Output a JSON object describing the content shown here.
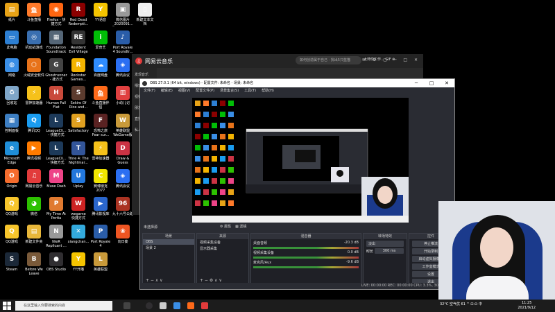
{
  "desktop_icons": [
    {
      "label": "纸片",
      "color": "#e8a317",
      "glyph": "▤",
      "col": 0,
      "row": 0
    },
    {
      "label": "斗鱼直播",
      "color": "#ff7a2a",
      "glyph": "鱼",
      "col": 1,
      "row": 0
    },
    {
      "label": "Firefox - 快\n捷方式",
      "color": "#ff6611",
      "glyph": "◉",
      "col": 2,
      "row": 0
    },
    {
      "label": "Red Dead\nRedempti...",
      "color": "#8b0000",
      "glyph": "R",
      "col": 3,
      "row": 0
    },
    {
      "label": "YY语音",
      "color": "#f5c400",
      "glyph": "Y",
      "col": 4,
      "row": 0
    },
    {
      "label": "微信图片\n_2020091...",
      "color": "#999999",
      "glyph": "▣",
      "col": 5,
      "row": 0
    },
    {
      "label": "新建文本文\n档",
      "color": "#eeeeee",
      "glyph": "▯",
      "col": 6,
      "row": 0
    },
    {
      "label": "此电脑",
      "color": "#2d7fd3",
      "glyph": "▭",
      "col": 0,
      "row": 1
    },
    {
      "label": "机动战游戏",
      "color": "#3a6fb0",
      "glyph": "◎",
      "col": 1,
      "row": 1
    },
    {
      "label": "Foundation\nSoundtrack",
      "color": "#556677",
      "glyph": "▦",
      "col": 2,
      "row": 1
    },
    {
      "label": "Resident\nEvil Village",
      "color": "#333333",
      "glyph": "RE",
      "col": 3,
      "row": 1
    },
    {
      "label": "爱奇艺",
      "color": "#00be06",
      "glyph": "i",
      "col": 4,
      "row": 1
    },
    {
      "label": "Port Royale\n4 Soundtr...",
      "color": "#2a5da8",
      "glyph": "♪",
      "col": 5,
      "row": 1
    },
    {
      "label": "网络",
      "color": "#3a8ee6",
      "glyph": "◍",
      "col": 0,
      "row": 2
    },
    {
      "label": "火绒安全软件",
      "color": "#e8731a",
      "glyph": "⬡",
      "col": 1,
      "row": 2
    },
    {
      "label": "Ghostrunner\n- 捷方式",
      "color": "#444444",
      "glyph": "G",
      "col": 2,
      "row": 2
    },
    {
      "label": "Rockstar\nGames...",
      "color": "#f4b400",
      "glyph": "R",
      "col": 3,
      "row": 2
    },
    {
      "label": "百度网盘",
      "color": "#2f8cff",
      "glyph": "☁",
      "col": 4,
      "row": 2
    },
    {
      "label": "腾讯会议",
      "color": "#2b6ff2",
      "glyph": "◈",
      "col": 5,
      "row": 2
    },
    {
      "label": "回收站",
      "color": "#7fa6c8",
      "glyph": "♻",
      "col": 0,
      "row": 3
    },
    {
      "label": "雷神加速器",
      "color": "#f6c11a",
      "glyph": "⚡",
      "col": 1,
      "row": 3
    },
    {
      "label": "Human Fall\nFlat",
      "color": "#c94a3b",
      "glyph": "H",
      "col": 2,
      "row": 3
    },
    {
      "label": "Sekiro Of\nRice and...",
      "color": "#5c3b2e",
      "glyph": "S",
      "col": 3,
      "row": 3
    },
    {
      "label": "斗鱼直播伴\n侣",
      "color": "#ff6a1a",
      "glyph": "鱼",
      "col": 4,
      "row": 3
    },
    {
      "label": "小幼儿记",
      "color": "#e04040",
      "glyph": "▥",
      "col": 5,
      "row": 3
    },
    {
      "label": "控制面板",
      "color": "#3d7ec2",
      "glyph": "▦",
      "col": 0,
      "row": 4
    },
    {
      "label": "腾讯QQ",
      "color": "#1a9cf0",
      "glyph": "Q",
      "col": 1,
      "row": 4
    },
    {
      "label": "LeagueCli...\n- 快捷方式",
      "color": "#1d3a5a",
      "glyph": "L",
      "col": 2,
      "row": 4
    },
    {
      "label": "Satisfactory",
      "color": "#e0a020",
      "glyph": "S",
      "col": 3,
      "row": 4
    },
    {
      "label": "恐怖之旅\nFear sur...",
      "color": "#5a2222",
      "glyph": "F",
      "col": 4,
      "row": 4
    },
    {
      "label": "英雄联盟\nWeGame版",
      "color": "#c99a3a",
      "glyph": "W",
      "col": 5,
      "row": 4
    },
    {
      "label": "Microsoft\nEdge",
      "color": "#1f8ed8",
      "glyph": "e",
      "col": 0,
      "row": 5
    },
    {
      "label": "腾讯视频",
      "color": "#ff7b00",
      "glyph": "▶",
      "col": 1,
      "row": 5
    },
    {
      "label": "LeagueCli...\n- 快捷方式",
      "color": "#1d3a5a",
      "glyph": "L",
      "col": 2,
      "row": 5
    },
    {
      "label": "Trine 4: The\nNightmar...",
      "color": "#335599",
      "glyph": "T",
      "col": 3,
      "row": 5
    },
    {
      "label": "雷神加速器",
      "color": "#f6c11a",
      "glyph": "⚡",
      "col": 4,
      "row": 5
    },
    {
      "label": "Draw &\nGuess",
      "color": "#cc3344",
      "glyph": "D",
      "col": 5,
      "row": 5
    },
    {
      "label": "Origin",
      "color": "#f56c2d",
      "glyph": "O",
      "col": 0,
      "row": 6
    },
    {
      "label": "网易云音乐",
      "color": "#e23b3b",
      "glyph": "♫",
      "col": 1,
      "row": 6
    },
    {
      "label": "Muse Dash",
      "color": "#ee4488",
      "glyph": "M",
      "col": 2,
      "row": 6
    },
    {
      "label": "Uplay",
      "color": "#2277dd",
      "glyph": "U",
      "col": 3,
      "row": 6
    },
    {
      "label": "赛博朋克\n2077",
      "color": "#f2e600",
      "glyph": "C",
      "col": 4,
      "row": 6
    },
    {
      "label": "腾讯会议",
      "color": "#2b6ff2",
      "glyph": "◈",
      "col": 5,
      "row": 6
    },
    {
      "label": "QQ游戏",
      "color": "#f7c52b",
      "glyph": "Q",
      "col": 0,
      "row": 7
    },
    {
      "label": "微信",
      "color": "#2dc100",
      "glyph": "◕",
      "col": 1,
      "row": 7
    },
    {
      "label": "My Time At\nPortia",
      "color": "#e07a30",
      "glyph": "P",
      "col": 2,
      "row": 7
    },
    {
      "label": "wegame\n快捷方式",
      "color": "#cc2222",
      "glyph": "W",
      "col": 3,
      "row": 7
    },
    {
      "label": "腾讯影视库",
      "color": "#2a66cc",
      "glyph": "▶",
      "col": 4,
      "row": 7
    },
    {
      "label": "九十六号公路",
      "color": "#aa3322",
      "glyph": "96",
      "col": 5,
      "row": 7
    },
    {
      "label": "QQ游戏",
      "color": "#f7c52b",
      "glyph": "Q",
      "col": 0,
      "row": 8
    },
    {
      "label": "新建文件夹",
      "color": "#e8b73a",
      "glyph": "▤",
      "col": 1,
      "row": 8
    },
    {
      "label": "NieR\nReplicant ...",
      "color": "#999999",
      "glyph": "N",
      "col": 2,
      "row": 8
    },
    {
      "label": "xiangchan...",
      "color": "#33aadd",
      "glyph": "✕",
      "col": 3,
      "row": 8
    },
    {
      "label": "Port Royale\n4",
      "color": "#2a5da8",
      "glyph": "P",
      "col": 4,
      "row": 8
    },
    {
      "label": "向日葵",
      "color": "#ee5522",
      "glyph": "❀",
      "col": 5,
      "row": 8
    },
    {
      "label": "Steam",
      "color": "#1b2838",
      "glyph": "S",
      "col": 0,
      "row": 9
    },
    {
      "label": "Before We\nLeave",
      "color": "#7a5a3a",
      "glyph": "B",
      "col": 1,
      "row": 9
    },
    {
      "label": "OBS Studio",
      "color": "#302e31",
      "glyph": "●",
      "col": 2,
      "row": 9
    },
    {
      "label": "YY开播",
      "color": "#f5c400",
      "glyph": "Y",
      "col": 3,
      "row": 9
    },
    {
      "label": "英雄联盟",
      "color": "#c99a3a",
      "glyph": "L",
      "col": 4,
      "row": 9
    }
  ],
  "netease": {
    "title": "网易云音乐",
    "search_placeholder": "如何创造属于自己 · 找出5只蓝猫",
    "user": "大师你工作... GIF ⊗",
    "tools": "✉ ⚙ ▢ ─ □ ✕",
    "sidebar": [
      "发现音乐",
      "播客",
      "视频",
      "朋友",
      "直播",
      "私人FM"
    ]
  },
  "obs": {
    "title": "OBS 27.0.1 (64 bit, windows) - 配置文件: 未命名 - 场景: 未命名",
    "win_buttons": [
      "─",
      "□",
      "✕"
    ],
    "menu": [
      "文件(F)",
      "编辑(E)",
      "视图(V)",
      "配置文件(P)",
      "场景集合(S)",
      "工具(T)",
      "帮助(H)"
    ],
    "scene_label": "未选择源",
    "tabs": [
      "⚙ 属性",
      "▦ 滤镜"
    ],
    "panels": {
      "scenes": {
        "title": "场景",
        "items": [
          "OBS",
          "场景 2"
        ]
      },
      "sources": {
        "title": "来源",
        "items": [
          "视频采集设备",
          "显示器采集"
        ]
      },
      "mixer": {
        "title": "混音器",
        "items": [
          {
            "name": "桌面音频",
            "db": "-20.3 dB"
          },
          {
            "name": "视频采集设备",
            "db": "0.0 dB"
          },
          {
            "name": "麦克风/Aux",
            "db": "-9.6 dB"
          }
        ]
      },
      "transitions": {
        "title": "转场特效",
        "mode": "淡出",
        "duration_label": "时长",
        "duration": "300 ms"
      },
      "controls": {
        "title": "控件",
        "items": [
          "停止推流",
          "开始录制",
          "启动虚拟摄像机",
          "工作室模式",
          "设置",
          "退出"
        ]
      }
    },
    "status": "LIVE: 00:00:00   REC: 00:00:00   CPU: 3.3%, 30.00 fps"
  },
  "taskbar": {
    "search_placeholder": "在这里输入你要搜索的内容",
    "tray": "32°C 空气优 61  ^  ⊡  ☊  中",
    "time": "11:25",
    "date": "2021/9/12"
  }
}
